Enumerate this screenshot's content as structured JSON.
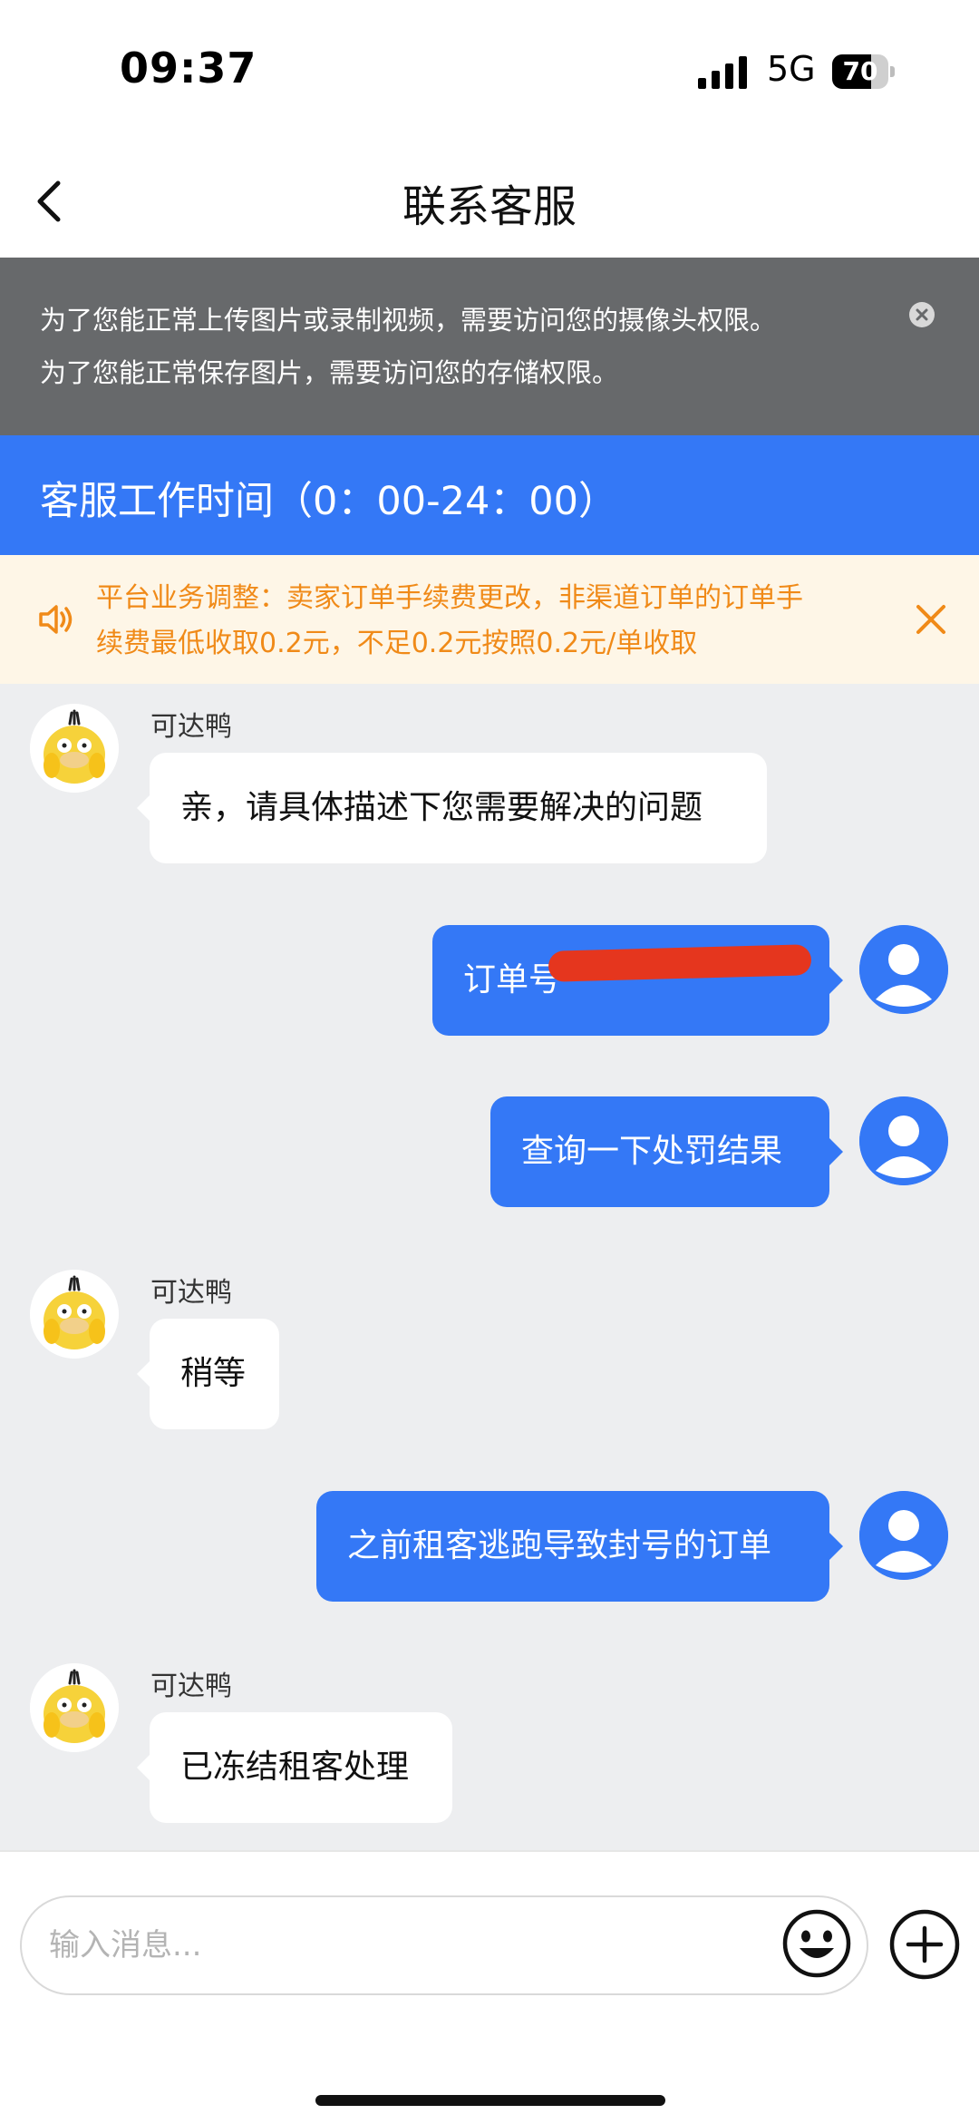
{
  "status_bar": {
    "time": "09:37",
    "network": "5G",
    "battery": "70",
    "battery_level": 0.7
  },
  "nav": {
    "title": "联系客服"
  },
  "permission_banner": {
    "line1": "为了您能正常上传图片或录制视频，需要访问您的摄像头权限。",
    "line2": "为了您能正常保存图片，需要访问您的存储权限。"
  },
  "hours_banner": {
    "text": "客服工作时间（0：00-24：00）"
  },
  "notice": {
    "line1": "平台业务调整：卖家订单手续费更改，非渠道订单的订单手",
    "line2": "续费最低收取0.2元，不足0.2元按照0.2元/单收取"
  },
  "messages": [
    {
      "side": "left",
      "sender": "可达鸭",
      "text": "亲，请具体描述下您需要解决的问题"
    },
    {
      "side": "right",
      "text": "订单号"
    },
    {
      "side": "right",
      "text": "查询一下处罚结果"
    },
    {
      "side": "left",
      "sender": "可达鸭",
      "text": "稍等"
    },
    {
      "side": "right",
      "text": "之前租客逃跑导致封号的订单"
    },
    {
      "side": "left",
      "sender": "可达鸭",
      "text": "已冻结租客处理"
    }
  ],
  "input": {
    "placeholder": "输入消息..."
  },
  "colors": {
    "accent": "#3478f6",
    "notice_text": "#f08a18",
    "notice_bg": "#fef6e7",
    "banner_bg": "#67696b",
    "chat_bg": "#edeef0",
    "redaction": "#e5361e"
  },
  "icons": {
    "back": "chevron-left-icon",
    "close_perm": "close-circle-icon",
    "speaker": "speaker-icon",
    "close_notice": "close-icon",
    "emoji": "smiley-icon",
    "plus": "plus-circle-icon",
    "bot_avatar": "psyduck-avatar-icon",
    "user_avatar": "user-avatar-icon"
  }
}
